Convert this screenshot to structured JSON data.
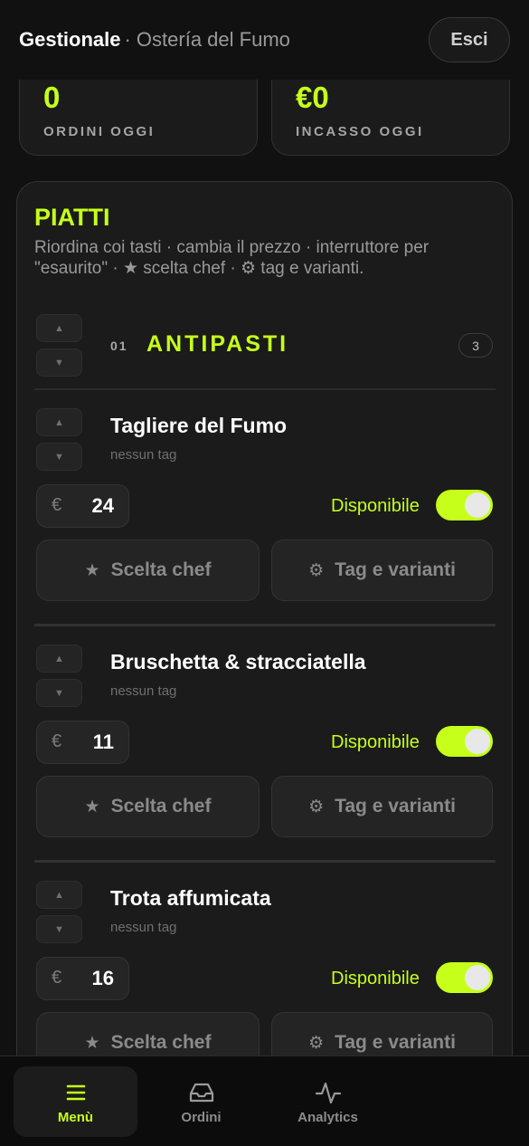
{
  "header": {
    "title": "Gestionale",
    "subtitle": "· Ostería del Fumo",
    "logout_label": "Esci"
  },
  "stats": [
    {
      "value": "0",
      "label": "ORDINI OGGI"
    },
    {
      "value": "€0",
      "label": "INCASSO OGGI"
    }
  ],
  "panel": {
    "title": "PIATTI",
    "description": "Riordina coi tasti · cambia il prezzo · interruttore per \"esaurito\" · ★ scelta chef · ⚙ tag e varianti.",
    "up_arrow": "▲",
    "down_arrow": "▼"
  },
  "category": {
    "number": "01",
    "name": "ANTIPASTI",
    "count": "3"
  },
  "dishes": [
    {
      "name": "Tagliere del Fumo",
      "tags": "nessun tag",
      "currency": "€",
      "price": "24",
      "available_label": "Disponibile",
      "available": true,
      "chef_icon": "★",
      "chef_label": "Scelta chef",
      "tags_icon": "⚙",
      "tags_label": "Tag e varianti"
    },
    {
      "name": "Bruschetta & stracciatella",
      "tags": "nessun tag",
      "currency": "€",
      "price": "11",
      "available_label": "Disponibile",
      "available": true,
      "chef_icon": "★",
      "chef_label": "Scelta chef",
      "tags_icon": "⚙",
      "tags_label": "Tag e varianti"
    },
    {
      "name": "Trota affumicata",
      "tags": "nessun tag",
      "currency": "€",
      "price": "16",
      "available_label": "Disponibile",
      "available": true,
      "chef_icon": "★",
      "chef_label": "Scelta chef",
      "tags_icon": "⚙",
      "tags_label": "Tag e varianti"
    }
  ],
  "nav": [
    {
      "label": "Menù",
      "icon": "menu-icon",
      "active": true
    },
    {
      "label": "Ordini",
      "icon": "inbox-icon",
      "active": false
    },
    {
      "label": "Analytics",
      "icon": "activity-icon",
      "active": false
    }
  ],
  "colors": {
    "accent": "#c6ff1a",
    "background": "#111111",
    "card": "#1b1b1b"
  }
}
